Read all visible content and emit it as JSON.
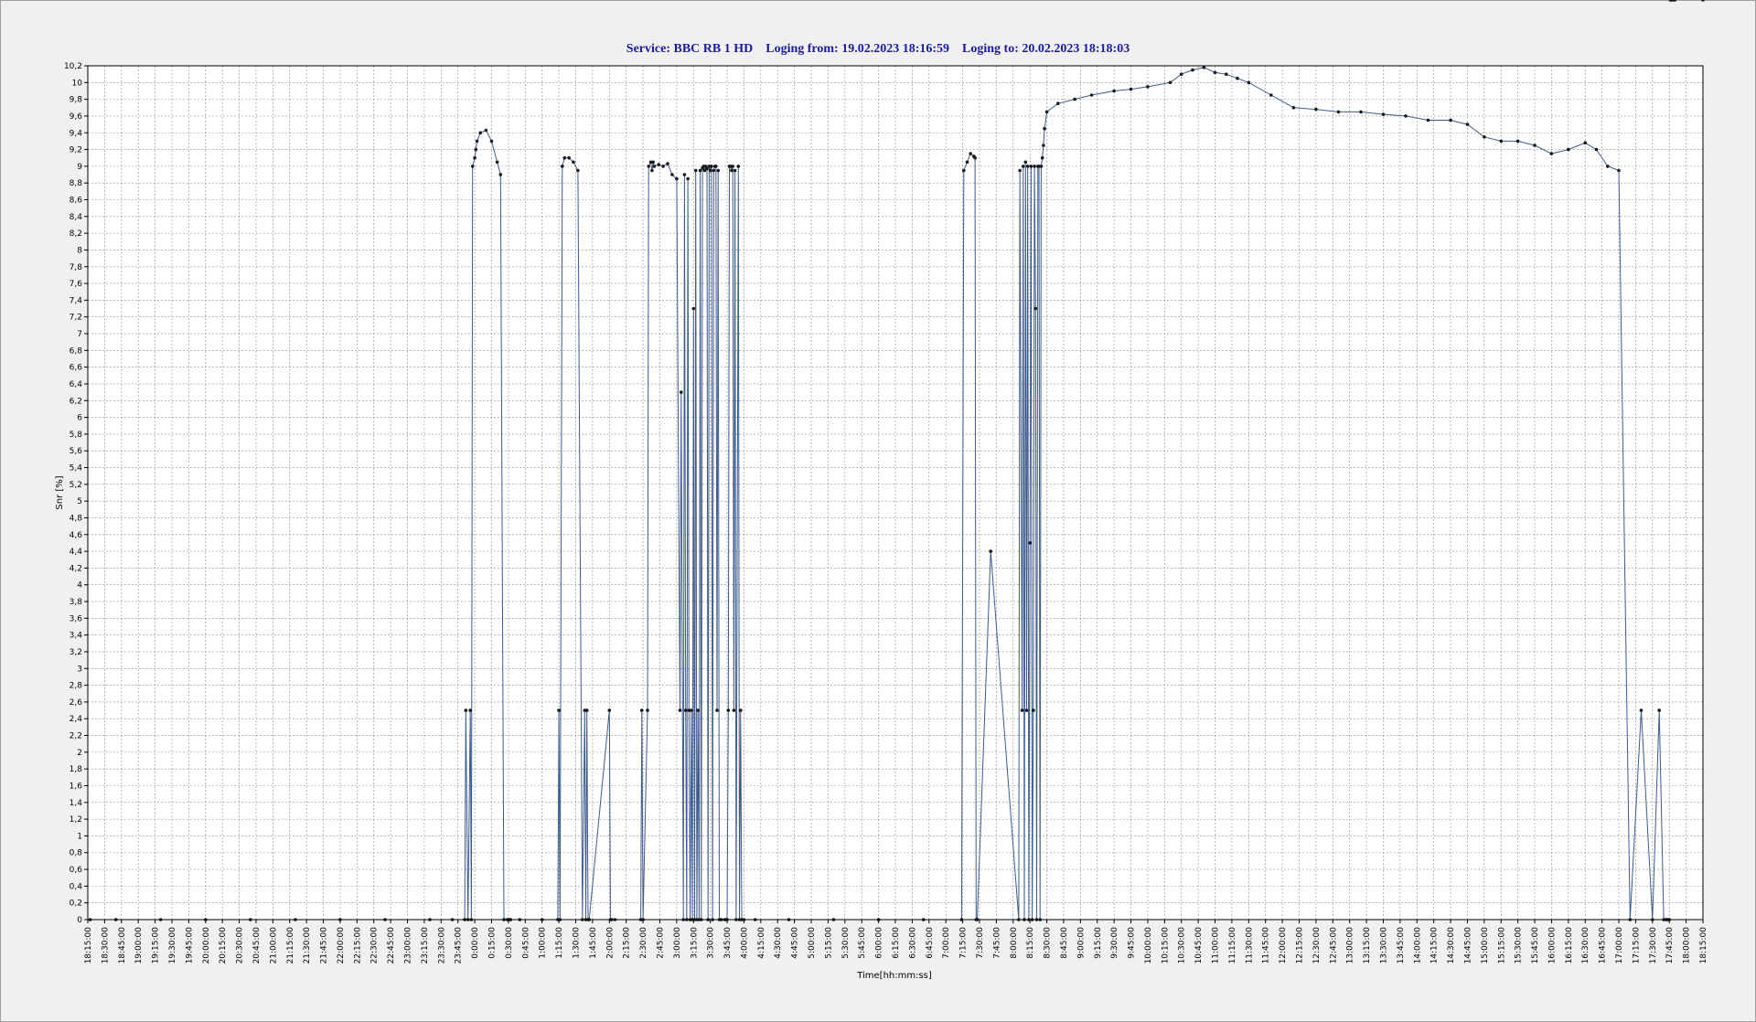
{
  "title": {
    "service_label": "Service:",
    "service": "BBC RB 1 HD",
    "from_label": "Loging from:",
    "from": "19.02.2023 18:16:59",
    "to_label": "Loging to:",
    "to": "20.02.2023 18:18:03"
  },
  "chart_data": {
    "type": "line",
    "xlabel": "Time[hh:mm:ss]",
    "ylabel": "Snr [%]",
    "ylim": [
      0,
      10.2
    ],
    "xlim_minutes": [
      1095,
      2535
    ],
    "grid": true,
    "series_color": "#3c5a8c",
    "marker_color": "#1a1a1a",
    "y_ticks": [
      "0",
      "0,2",
      "0,4",
      "0,6",
      "0,8",
      "1",
      "1,2",
      "1,4",
      "1,6",
      "1,8",
      "2",
      "2,2",
      "2,4",
      "2,6",
      "2,8",
      "3",
      "3,2",
      "3,4",
      "3,6",
      "3,8",
      "4",
      "4,2",
      "4,4",
      "4,6",
      "4,8",
      "5",
      "5,2",
      "5,4",
      "5,6",
      "5,8",
      "6",
      "6,2",
      "6,4",
      "6,6",
      "6,8",
      "7",
      "7,2",
      "7,4",
      "7,6",
      "7,8",
      "8",
      "8,2",
      "8,4",
      "8,6",
      "8,8",
      "9",
      "9,2",
      "9,4",
      "9,6",
      "9,8",
      "10",
      "10,2"
    ],
    "x_ticks": [
      "18:15:00",
      "18:30:00",
      "18:45:00",
      "19:00:00",
      "19:15:00",
      "19:30:00",
      "19:45:00",
      "20:00:00",
      "20:15:00",
      "20:30:00",
      "20:45:00",
      "21:00:00",
      "21:15:00",
      "21:30:00",
      "21:45:00",
      "22:00:00",
      "22:15:00",
      "22:30:00",
      "22:45:00",
      "23:00:00",
      "23:15:00",
      "23:30:00",
      "23:45:00",
      "0:00:00",
      "0:15:00",
      "0:30:00",
      "0:45:00",
      "1:00:00",
      "1:15:00",
      "1:30:00",
      "1:45:00",
      "2:00:00",
      "2:15:00",
      "2:30:00",
      "2:45:00",
      "3:00:00",
      "3:15:00",
      "3:30:00",
      "3:45:00",
      "4:00:00",
      "4:15:00",
      "4:30:00",
      "4:45:00",
      "5:00:00",
      "5:15:00",
      "5:30:00",
      "5:45:00",
      "6:00:00",
      "6:15:00",
      "6:30:00",
      "6:45:00",
      "7:00:00",
      "7:15:00",
      "7:30:00",
      "7:45:00",
      "8:00:00",
      "8:15:00",
      "8:30:00",
      "8:45:00",
      "9:00:00",
      "9:15:00",
      "9:30:00",
      "9:45:00",
      "10:00:00",
      "10:15:00",
      "10:30:00",
      "10:45:00",
      "11:00:00",
      "11:15:00",
      "11:30:00",
      "11:45:00",
      "12:00:00",
      "12:15:00",
      "12:30:00",
      "12:45:00",
      "13:00:00",
      "13:15:00",
      "13:30:00",
      "13:45:00",
      "14:00:00",
      "14:15:00",
      "14:30:00",
      "14:45:00",
      "15:00:00",
      "15:15:00",
      "15:30:00",
      "15:45:00",
      "16:00:00",
      "16:15:00",
      "16:30:00",
      "16:45:00",
      "17:00:00",
      "17:15:00",
      "17:30:00",
      "17:45:00",
      "18:00:00",
      "18:15:00"
    ],
    "series": [
      {
        "x_minutes": [
          1097,
          1120,
          1160,
          1200,
          1240,
          1280,
          1320,
          1360,
          1400,
          1420,
          1431,
          1432,
          1434,
          1436,
          1437,
          1438,
          1440,
          1441,
          1442,
          1445,
          1450,
          1455,
          1460,
          1463,
          1466,
          1469,
          1470,
          1471,
          1472,
          1480,
          1500,
          1514,
          1515,
          1516,
          1518,
          1520,
          1524,
          1528,
          1532,
          1536,
          1538,
          1539,
          1540,
          1541,
          1542,
          1560,
          1561,
          1562,
          1565,
          1588,
          1589,
          1590,
          1594,
          1595,
          1597,
          1598,
          1599,
          1600,
          1604,
          1608,
          1612,
          1616,
          1620,
          1623,
          1624,
          1626,
          1627,
          1628,
          1629,
          1630,
          1631,
          1632,
          1633,
          1634,
          1635,
          1636,
          1637,
          1638,
          1639,
          1640,
          1641,
          1642,
          1643,
          1644,
          1645,
          1646,
          1647,
          1648,
          1649,
          1650,
          1651,
          1652,
          1653,
          1654,
          1655,
          1656,
          1657,
          1658,
          1660,
          1663,
          1664,
          1665,
          1666,
          1667,
          1668,
          1669,
          1670,
          1671,
          1672,
          1673,
          1675,
          1676,
          1677,
          1678,
          1680,
          1690,
          1720,
          1760,
          1800,
          1840,
          1874,
          1876,
          1879,
          1882,
          1885,
          1886,
          1887,
          1888,
          1900,
          1925,
          1926,
          1928,
          1929,
          1930,
          1931,
          1932,
          1933,
          1934,
          1935,
          1936,
          1937,
          1938,
          1939,
          1940,
          1941,
          1942,
          1943,
          1944,
          1945,
          1946,
          1947,
          1948,
          1950,
          1960,
          1975,
          1990,
          2010,
          2025,
          2040,
          2060,
          2070,
          2080,
          2090,
          2100,
          2110,
          2120,
          2130,
          2150,
          2170,
          2190,
          2210,
          2230,
          2250,
          2270,
          2290,
          2310,
          2325,
          2340,
          2355,
          2370,
          2385,
          2400,
          2415,
          2430,
          2440,
          2450,
          2460,
          2470,
          2480,
          2490,
          2496,
          2500,
          2502,
          2503,
          2504,
          2505,
          2506,
          2507,
          2508,
          2510,
          2535
        ],
        "values": [
          0,
          0,
          0,
          0,
          0,
          0,
          0,
          0,
          0,
          0,
          0,
          2.5,
          0,
          2.5,
          0,
          9,
          9.1,
          9.2,
          9.3,
          9.4,
          9.43,
          9.3,
          9.05,
          8.9,
          0,
          0,
          0,
          0,
          0,
          0,
          0,
          0,
          2.5,
          0,
          9,
          9.1,
          9.1,
          9.05,
          8.95,
          0,
          2.5,
          0,
          2.5,
          0,
          0,
          2.5,
          0,
          0,
          0,
          0,
          2.5,
          0,
          2.5,
          9,
          9.05,
          8.95,
          9.05,
          9,
          9.02,
          9,
          9.03,
          8.9,
          8.85,
          2.5,
          6.3,
          0,
          8.9,
          2.5,
          0,
          8.85,
          2.5,
          0,
          2.5,
          0,
          7.3,
          0,
          8.95,
          0,
          2.5,
          0,
          8.95,
          0,
          8.98,
          9,
          8.95,
          9,
          8.97,
          0,
          9,
          8.95,
          9,
          0,
          8.95,
          9,
          9,
          2.5,
          8.95,
          0,
          0,
          0,
          0,
          0,
          2.5,
          9,
          9,
          8.95,
          9,
          2.5,
          8.95,
          0,
          9,
          0,
          2.5,
          0,
          0,
          0,
          0,
          0,
          0,
          0,
          0,
          8.95,
          9.05,
          9.15,
          9.12,
          9.1,
          0,
          0,
          4.4,
          0,
          8.95,
          2.5,
          9,
          0,
          9.05,
          2.5,
          9,
          0,
          4.5,
          9,
          0,
          2.5,
          9,
          7.3,
          0,
          9,
          9,
          0,
          9,
          9.1,
          9.25,
          9.45,
          9.65,
          9.75,
          9.8,
          9.85,
          9.9,
          9.92,
          9.95,
          10.0,
          10.1,
          10.15,
          10.18,
          10.12,
          10.1,
          10.05,
          10.0,
          9.85,
          9.7,
          9.68,
          9.65,
          9.65,
          9.62,
          9.6,
          9.55,
          9.55,
          9.5,
          9.35,
          9.3,
          9.3,
          9.25,
          9.15,
          9.2,
          9.28,
          9.2,
          9.0,
          8.95,
          0,
          2.5,
          0,
          2.5,
          0,
          0,
          0,
          0,
          0
        ]
      }
    ]
  }
}
